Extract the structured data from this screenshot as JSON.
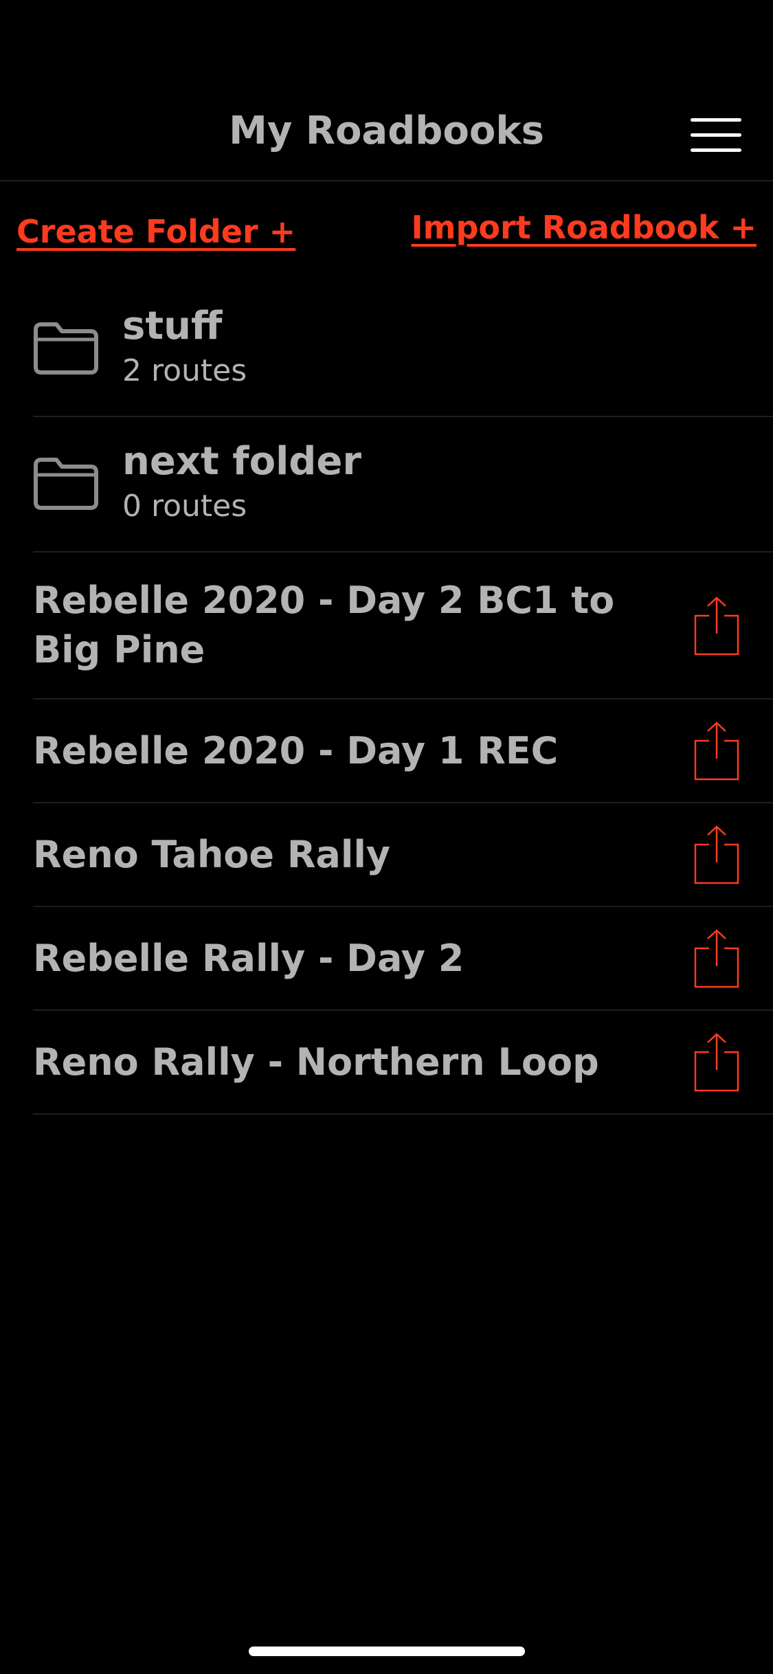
{
  "header": {
    "title": "My Roadbooks",
    "menu_icon": "hamburger-menu-icon"
  },
  "actions": {
    "create_folder": "Create Folder +",
    "import_roadbook": "Import Roadbook +"
  },
  "folders": [
    {
      "name": "stuff",
      "count": "2 routes"
    },
    {
      "name": "next folder",
      "count": "0 routes"
    }
  ],
  "routes": [
    {
      "title": "Rebelle 2020 - Day 2 BC1 to Big Pine"
    },
    {
      "title": "Rebelle 2020 - Day 1 REC"
    },
    {
      "title": "Reno Tahoe Rally"
    },
    {
      "title": "Rebelle Rally - Day 2"
    },
    {
      "title": "Reno Rally - Northern Loop"
    }
  ],
  "colors": {
    "background": "#000000",
    "accent": "#ff3b1f",
    "text": "#b3b3b3",
    "folder_icon": "#8c8c8c"
  },
  "icons": {
    "folder": "folder-icon",
    "share": "share-icon"
  }
}
